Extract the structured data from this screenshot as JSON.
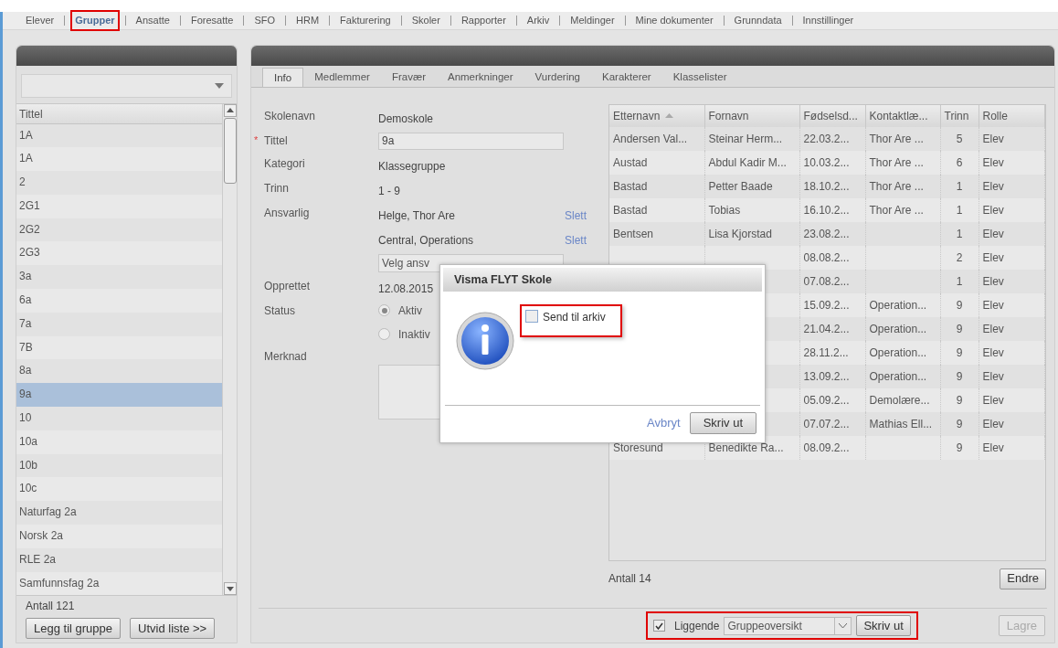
{
  "nav": [
    {
      "label": "Elever",
      "selected": false,
      "highlighted": false
    },
    {
      "label": "Grupper",
      "selected": true,
      "highlighted": true
    },
    {
      "label": "Ansatte",
      "selected": false,
      "highlighted": false
    },
    {
      "label": "Foresatte",
      "selected": false,
      "highlighted": false
    },
    {
      "label": "SFO",
      "selected": false,
      "highlighted": false
    },
    {
      "label": "HRM",
      "selected": false,
      "highlighted": false
    },
    {
      "label": "Fakturering",
      "selected": false,
      "highlighted": false
    },
    {
      "label": "Skoler",
      "selected": false,
      "highlighted": false
    },
    {
      "label": "Rapporter",
      "selected": false,
      "highlighted": false
    },
    {
      "label": "Arkiv",
      "selected": false,
      "highlighted": false
    },
    {
      "label": "Meldinger",
      "selected": false,
      "highlighted": false
    },
    {
      "label": "Mine dokumenter",
      "selected": false,
      "highlighted": false
    },
    {
      "label": "Grunndata",
      "selected": false,
      "highlighted": false
    },
    {
      "label": "Innstillinger",
      "selected": false,
      "highlighted": false
    }
  ],
  "group_list": {
    "column": "Tittel",
    "items": [
      {
        "label": "1A",
        "selected": false
      },
      {
        "label": "1A",
        "selected": false
      },
      {
        "label": "2",
        "selected": false
      },
      {
        "label": "2G1",
        "selected": false
      },
      {
        "label": "2G2",
        "selected": false
      },
      {
        "label": "2G3",
        "selected": false
      },
      {
        "label": "3a",
        "selected": false
      },
      {
        "label": "6a",
        "selected": false
      },
      {
        "label": "7a",
        "selected": false
      },
      {
        "label": "7B",
        "selected": false
      },
      {
        "label": "8a",
        "selected": false
      },
      {
        "label": "9a",
        "selected": true
      },
      {
        "label": "10",
        "selected": false
      },
      {
        "label": "10a",
        "selected": false
      },
      {
        "label": "10b",
        "selected": false
      },
      {
        "label": "10c",
        "selected": false
      },
      {
        "label": "Naturfag 2a",
        "selected": false
      },
      {
        "label": "Norsk 2a",
        "selected": false
      },
      {
        "label": "RLE 2a",
        "selected": false
      },
      {
        "label": "Samfunnsfag 2a",
        "selected": false
      }
    ],
    "count": "Antall 121",
    "buttons": [
      "Legg til gruppe",
      "Utvid liste >>"
    ]
  },
  "tabs": [
    {
      "label": "Info",
      "selected": true
    },
    {
      "label": "Medlemmer",
      "selected": false
    },
    {
      "label": "Fravær",
      "selected": false
    },
    {
      "label": "Anmerkninger",
      "selected": false
    },
    {
      "label": "Vurdering",
      "selected": false
    },
    {
      "label": "Karakterer",
      "selected": false
    },
    {
      "label": "Klasselister",
      "selected": false
    }
  ],
  "form": [
    {
      "kind": "text",
      "label": "Skolenavn",
      "value": "Demoskole"
    },
    {
      "kind": "input",
      "label": "Tittel",
      "value": "9a",
      "required_mark": "*"
    },
    {
      "kind": "text",
      "label": "Kategori",
      "value": "Klassegruppe"
    },
    {
      "kind": "text",
      "label": "Trinn",
      "value": "1 - 9"
    },
    {
      "kind": "person",
      "label": "Ansvarlig",
      "value": "Helge, Thor Are",
      "action": "Slett"
    },
    {
      "kind": "person",
      "value": "Central, Operations",
      "action": "Slett"
    },
    {
      "kind": "select",
      "value": "Velg ansv"
    },
    {
      "kind": "text",
      "label": "Opprettet",
      "value": "12.08.2015"
    },
    {
      "kind": "radio",
      "label": "Status",
      "options": [
        {
          "label": "Aktiv",
          "selected": true
        },
        {
          "label": "Inaktiv",
          "selected": false
        }
      ]
    },
    {
      "kind": "textarea",
      "label": "Merknad"
    }
  ],
  "members": {
    "columns": [
      {
        "label": "Etternavn",
        "sorted": true
      },
      {
        "label": "Fornavn",
        "sorted": false
      },
      {
        "label": "Fødselsd...",
        "sorted": false
      },
      {
        "label": "Kontaktlæ...",
        "sorted": false
      },
      {
        "label": "Trinn",
        "sorted": false
      },
      {
        "label": "Rolle",
        "sorted": false
      }
    ],
    "rows": [
      {
        "cells": [
          "Andersen Val...",
          "Steinar Herm...",
          "22.03.2...",
          "Thor Are ...",
          "5",
          "Elev"
        ]
      },
      {
        "cells": [
          "Austad",
          "Abdul Kadir M...",
          "10.03.2...",
          "Thor Are ...",
          "6",
          "Elev"
        ]
      },
      {
        "cells": [
          "Bastad",
          "Petter Baade",
          "18.10.2...",
          "Thor Are ...",
          "1",
          "Elev"
        ]
      },
      {
        "cells": [
          "Bastad",
          "Tobias",
          "16.10.2...",
          "Thor Are ...",
          "1",
          "Elev"
        ]
      },
      {
        "cells": [
          "Bentsen",
          "Lisa Kjorstad",
          "23.08.2...",
          null,
          "1",
          "Elev"
        ]
      },
      {
        "cells": [
          null,
          null,
          "08.08.2...",
          null,
          "2",
          "Elev"
        ]
      },
      {
        "cells": [
          null,
          null,
          "07.08.2...",
          null,
          "1",
          "Elev"
        ]
      },
      {
        "cells": [
          null,
          null,
          "15.09.2...",
          "Operation...",
          "9",
          "Elev"
        ]
      },
      {
        "cells": [
          null,
          null,
          "21.04.2...",
          "Operation...",
          "9",
          "Elev"
        ]
      },
      {
        "cells": [
          null,
          null,
          "28.11.2...",
          "Operation...",
          "9",
          "Elev"
        ]
      },
      {
        "cells": [
          null,
          null,
          "13.09.2...",
          "Operation...",
          "9",
          "Elev"
        ]
      },
      {
        "cells": [
          null,
          null,
          "05.09.2...",
          "Demolære...",
          "9",
          "Elev"
        ]
      },
      {
        "cells": [
          null,
          null,
          "07.07.2...",
          "Mathias Ell...",
          "9",
          "Elev"
        ]
      },
      {
        "cells": [
          "Storesund",
          "Benedikte Ra...",
          "08.09.2...",
          null,
          "9",
          "Elev"
        ]
      }
    ],
    "count": "Antall 14",
    "edit_button": "Endre"
  },
  "print_bar": {
    "highlighted": true,
    "landscape": {
      "label": "Liggende",
      "checked": true
    },
    "report": "Gruppeoversikt",
    "button": "Skriv ut"
  },
  "save_button": {
    "label": "Lagre",
    "disabled": true
  },
  "dialog": {
    "title": "Visma FLYT Skole",
    "option": {
      "label": "Send til arkiv",
      "checked": false,
      "highlighted": true
    },
    "cancel": "Avbryt",
    "confirm": "Skriv ut"
  }
}
